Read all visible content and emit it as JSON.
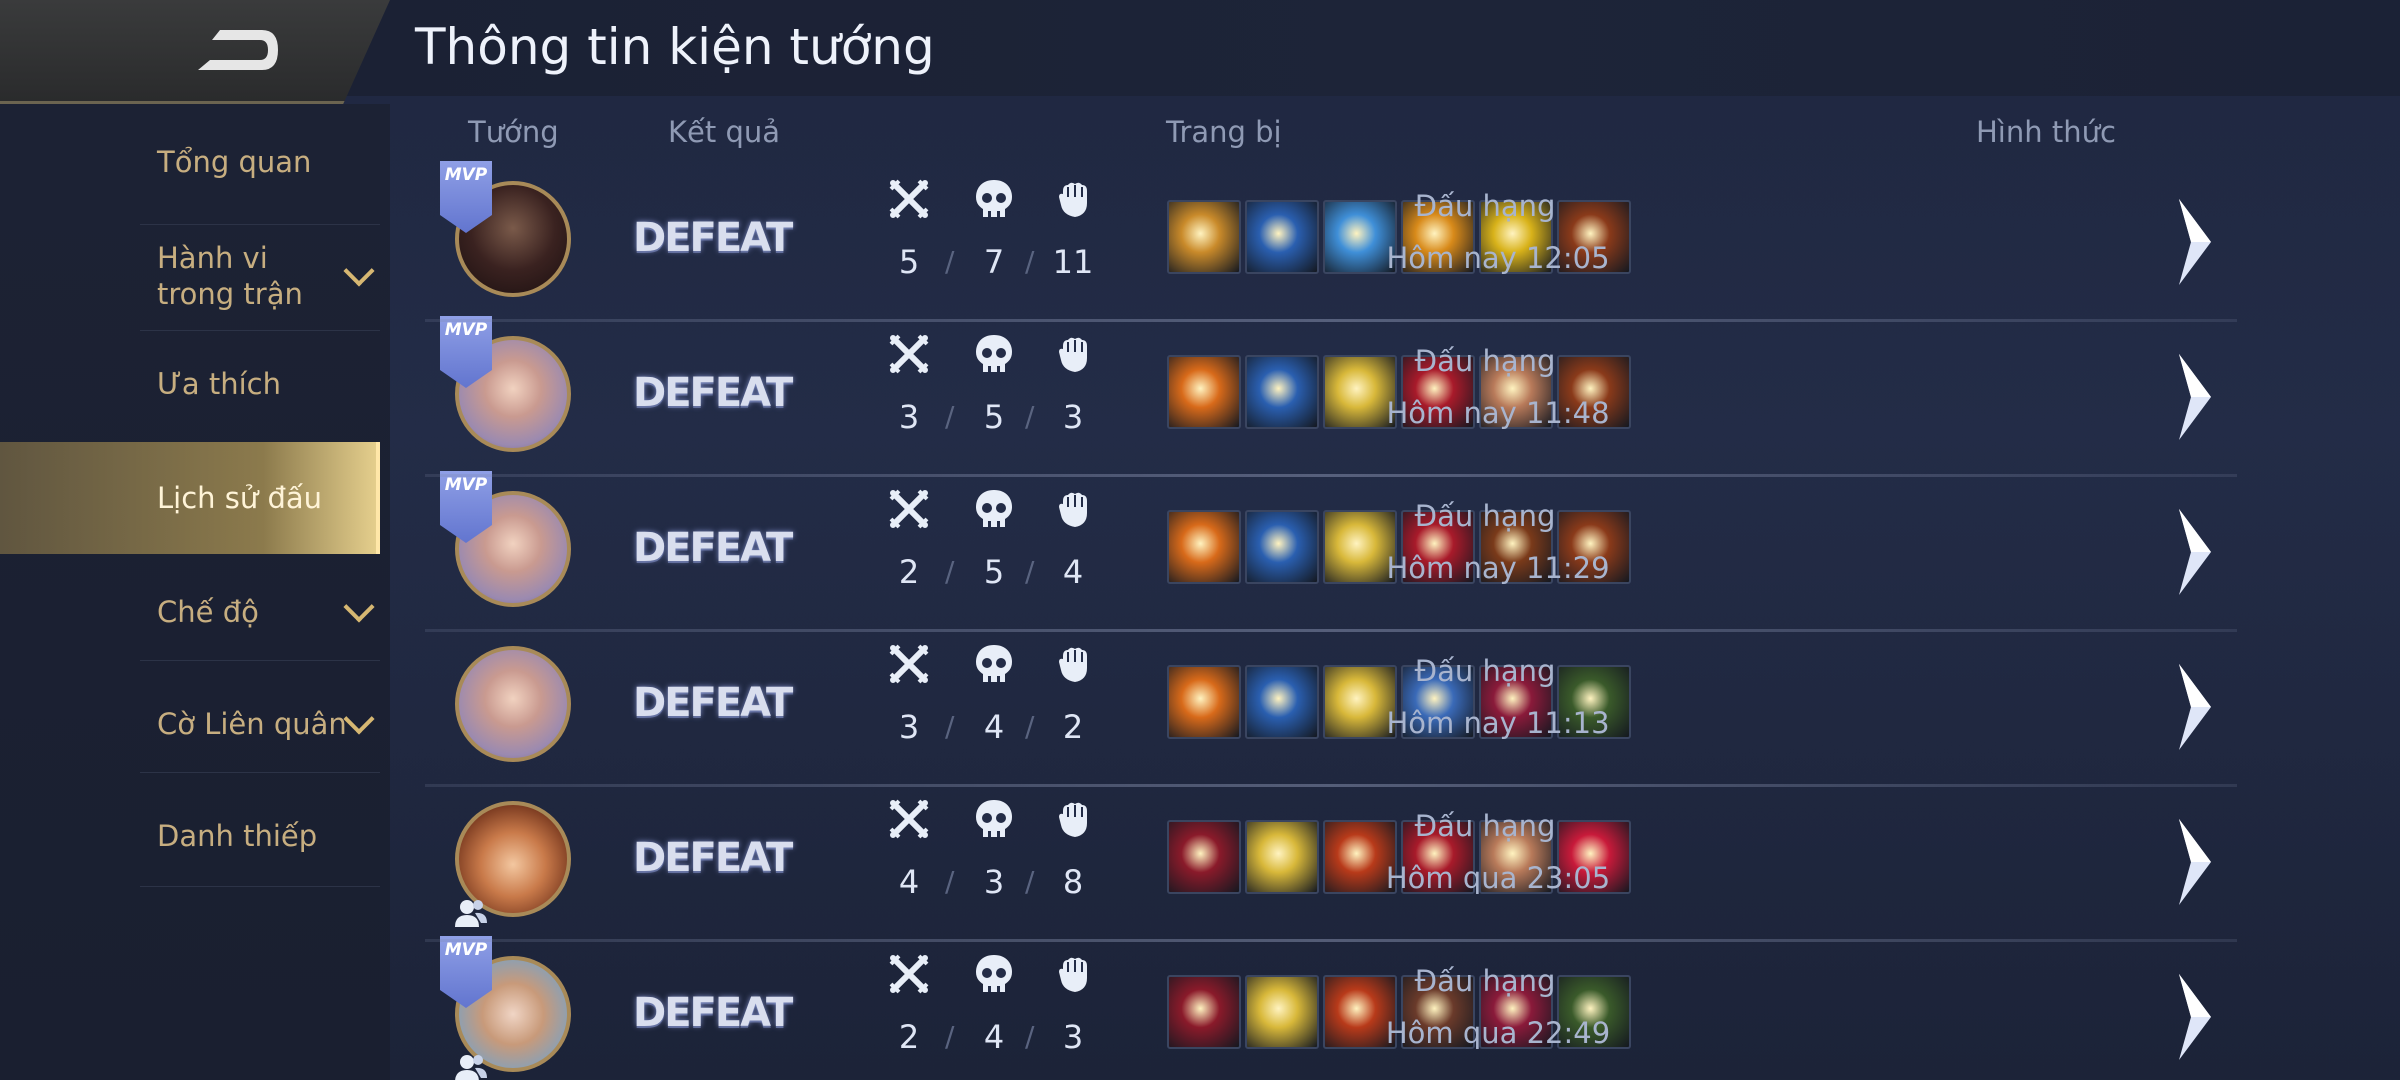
{
  "header": {
    "title": "Thông tin kiện tướng"
  },
  "sidebar": {
    "items": [
      {
        "label": "Tổng quan",
        "expandable": false,
        "active": false
      },
      {
        "label": "Hành vi trong trận",
        "expandable": true,
        "active": false
      },
      {
        "label": "Ưa thích",
        "expandable": false,
        "active": false
      },
      {
        "label": "Lịch sử đấu",
        "expandable": false,
        "active": true
      },
      {
        "label": "Chế độ",
        "expandable": true,
        "active": false
      },
      {
        "label": "Cờ Liên quân",
        "expandable": true,
        "active": false
      },
      {
        "label": "Danh thiếp",
        "expandable": false,
        "active": false
      }
    ]
  },
  "columns": {
    "hero": "Tướng",
    "result": "Kết quả",
    "items": "Trang bị",
    "mode": "Hình thức"
  },
  "matches": [
    {
      "mvp": true,
      "hero": "warrior",
      "friend": false,
      "result": "DEFEAT",
      "kills": "5",
      "deaths": "7",
      "assists": "11",
      "items": [
        "#c98a2a",
        "#2a5fb0",
        "#3f8fd8",
        "#d88a1a",
        "#d8b21a",
        "#8a3a1a"
      ],
      "mode": "Đấu hạng",
      "time": "Hôm nay 12:05"
    },
    {
      "mvp": true,
      "hero": "girl",
      "friend": false,
      "result": "DEFEAT",
      "kills": "3",
      "deaths": "5",
      "assists": "3",
      "items": [
        "#d86a1a",
        "#2a5fb0",
        "#d8b83a",
        "#a81a2a",
        "#b87a5a",
        "#8a3a1a"
      ],
      "mode": "Đấu hạng",
      "time": "Hôm nay 11:48"
    },
    {
      "mvp": true,
      "hero": "girl",
      "friend": false,
      "result": "DEFEAT",
      "kills": "2",
      "deaths": "5",
      "assists": "4",
      "items": [
        "#d86a1a",
        "#2a5fb0",
        "#d8b83a",
        "#a81a2a",
        "#7a3a1a",
        "#8a3a1a"
      ],
      "mode": "Đấu hạng",
      "time": "Hôm nay 11:29"
    },
    {
      "mvp": false,
      "hero": "girl",
      "friend": false,
      "result": "DEFEAT",
      "kills": "3",
      "deaths": "4",
      "assists": "2",
      "items": [
        "#d86a1a",
        "#2a5fb0",
        "#d8b83a",
        "#3a6ab8",
        "#8a1a3a",
        "#3a5a2a"
      ],
      "mode": "Đấu hạng",
      "time": "Hôm nay 11:13"
    },
    {
      "mvp": false,
      "hero": "kid",
      "friend": true,
      "result": "DEFEAT",
      "kills": "4",
      "deaths": "3",
      "assists": "8",
      "items": [
        "#8a1a2a",
        "#d8b83a",
        "#b83a1a",
        "#a81a2a",
        "#b87a5a",
        "#c81a3a"
      ],
      "mode": "Đấu hạng",
      "time": "Hôm qua 23:05"
    },
    {
      "mvp": true,
      "hero": "goggle",
      "friend": true,
      "result": "DEFEAT",
      "kills": "2",
      "deaths": "4",
      "assists": "3",
      "items": [
        "#8a1a2a",
        "#d8b83a",
        "#b83a1a",
        "#6a3a2a",
        "#8a1a3a",
        "#3a5a2a"
      ],
      "mode": "Đấu hạng",
      "time": "Hôm qua 22:49"
    }
  ],
  "icons": {
    "back": "back-arrow-icon",
    "kills": "crossed-swords-icon",
    "deaths": "skull-icon",
    "assists": "fist-icon",
    "row_detail": "chevron-right-icon",
    "friend": "friend-icon"
  }
}
